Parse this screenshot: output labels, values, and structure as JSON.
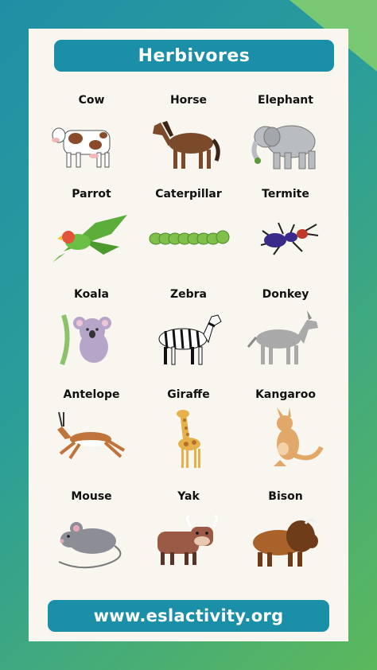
{
  "title": "Herbivores",
  "footer": "www.eslactivity.org",
  "animals": [
    {
      "label": "Cow",
      "icon": "cow-icon"
    },
    {
      "label": "Horse",
      "icon": "horse-icon"
    },
    {
      "label": "Elephant",
      "icon": "elephant-icon"
    },
    {
      "label": "Parrot",
      "icon": "parrot-icon"
    },
    {
      "label": "Caterpillar",
      "icon": "caterpillar-icon"
    },
    {
      "label": "Termite",
      "icon": "termite-icon"
    },
    {
      "label": "Koala",
      "icon": "koala-icon"
    },
    {
      "label": "Zebra",
      "icon": "zebra-icon"
    },
    {
      "label": "Donkey",
      "icon": "donkey-icon"
    },
    {
      "label": "Antelope",
      "icon": "antelope-icon"
    },
    {
      "label": "Giraffe",
      "icon": "giraffe-icon"
    },
    {
      "label": "Kangaroo",
      "icon": "kangaroo-icon"
    },
    {
      "label": "Mouse",
      "icon": "mouse-icon"
    },
    {
      "label": "Yak",
      "icon": "yak-icon"
    },
    {
      "label": "Bison",
      "icon": "bison-icon"
    }
  ],
  "colors": {
    "accent": "#1b8fa7",
    "card": "#f8f6ee"
  }
}
